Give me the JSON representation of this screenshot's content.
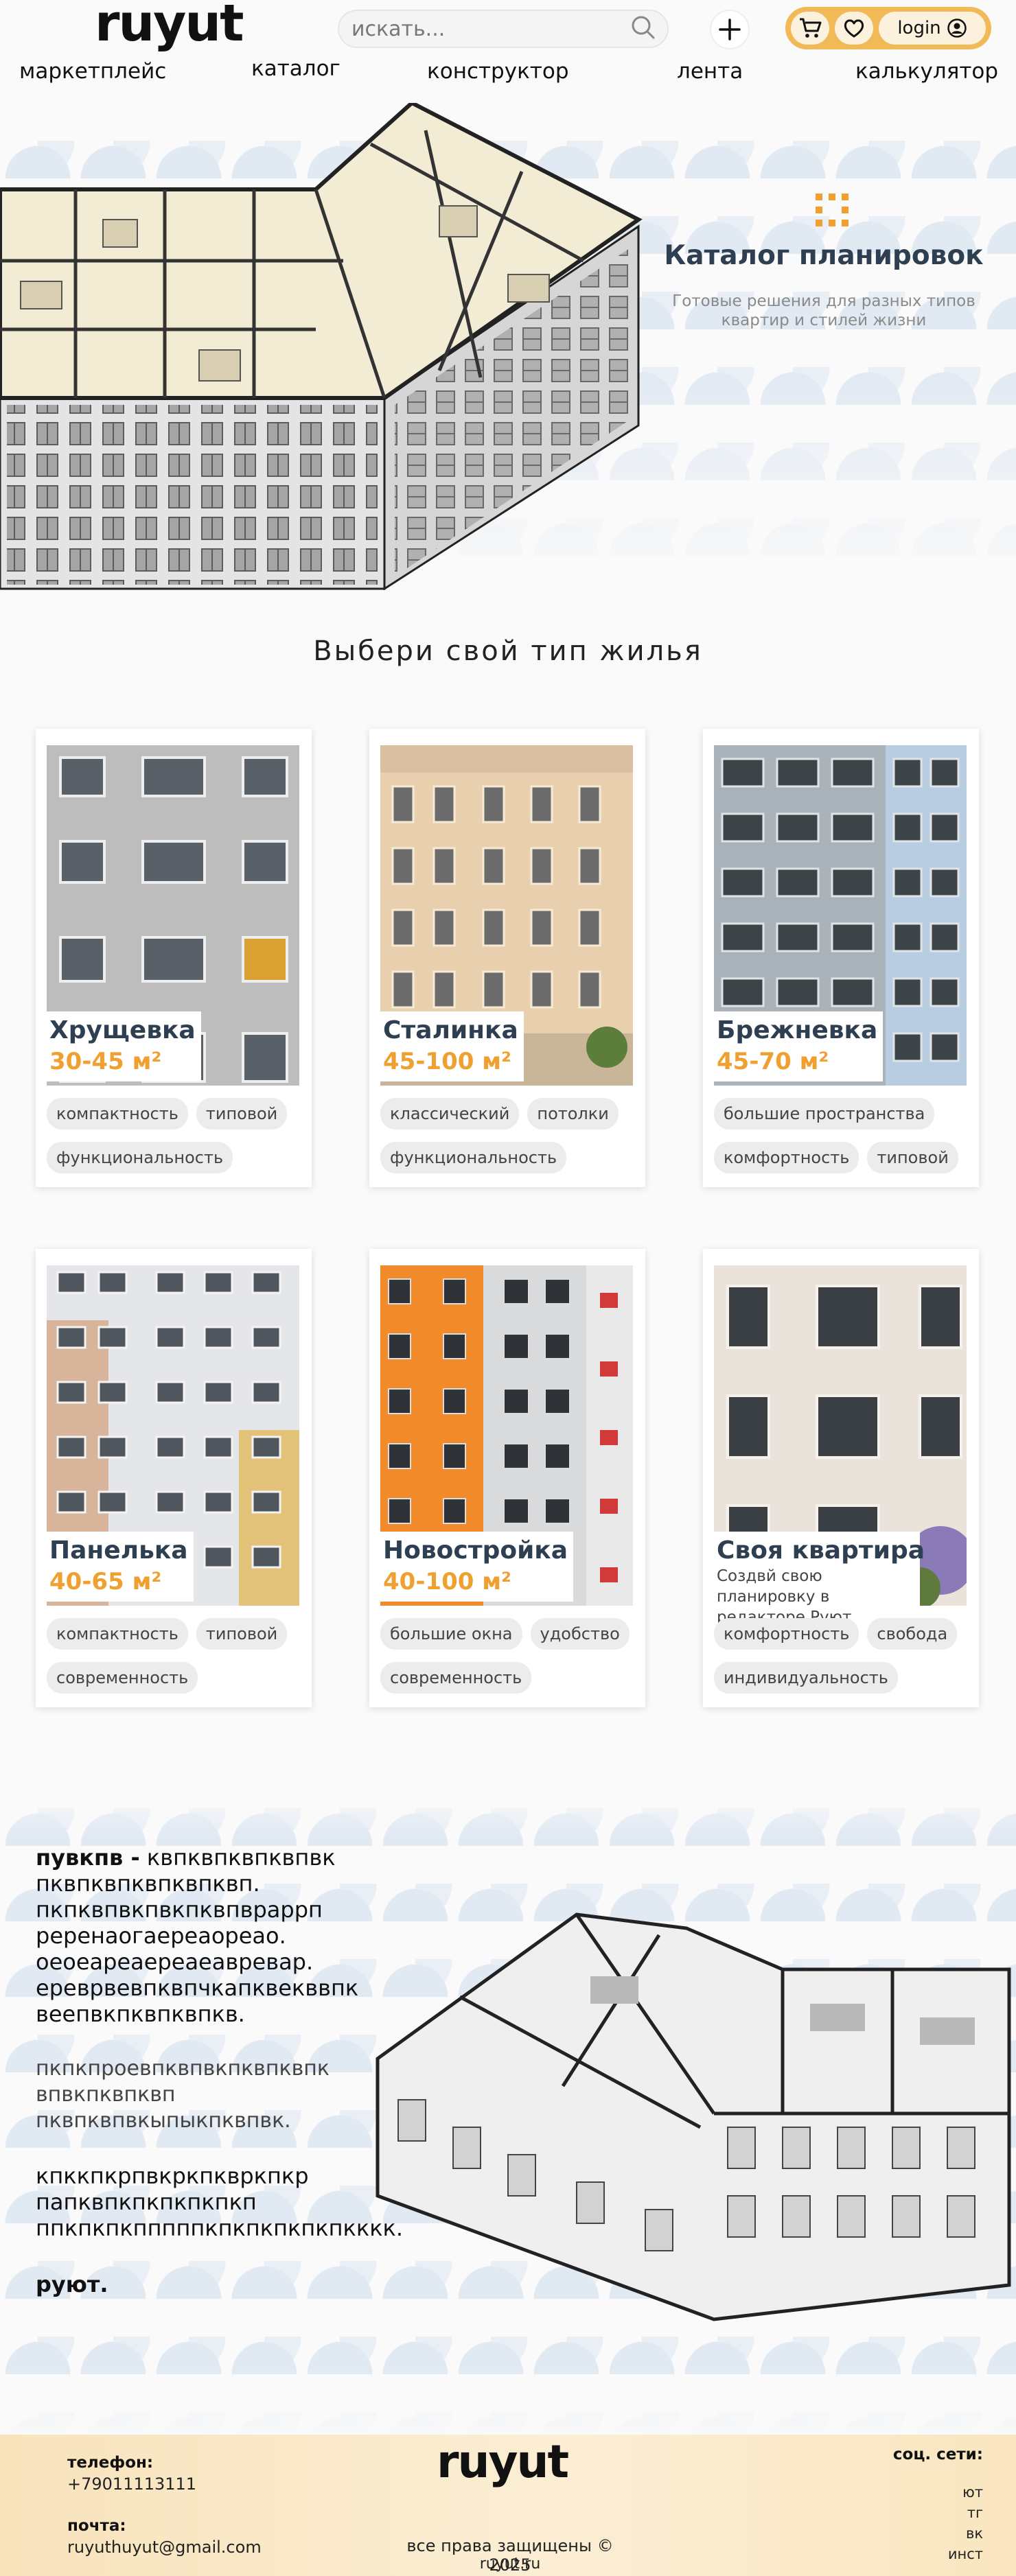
{
  "header": {
    "logo": "ruyut",
    "search_placeholder": "искать...",
    "login_label": "login"
  },
  "nav": [
    "маркетплейс",
    "каталог",
    "конструктор",
    "лента",
    "калькулятор"
  ],
  "hero": {
    "title": "Каталог планировок",
    "subtitle": "Готовые решения для разных типов квартир и стилей жизни"
  },
  "section_title": "Выбери свой тип жилья",
  "cards": [
    {
      "name": "Хрущевка",
      "area": "30-45 м²",
      "tags": [
        "компактность",
        "типовой",
        "функциональность"
      ]
    },
    {
      "name": "Сталинка",
      "area": "45-100 м²",
      "tags": [
        "классический",
        "потолки",
        "функциональность"
      ]
    },
    {
      "name": "Брежневка",
      "area": "45-70 м²",
      "tags": [
        "большие пространства",
        "комфортность",
        "типовой"
      ]
    },
    {
      "name": "Панелька",
      "area": "40-65 м²",
      "tags": [
        "компактность",
        "типовой",
        "современность"
      ]
    },
    {
      "name": "Новостройка",
      "area": "40-100 м²",
      "tags": [
        "большие окна",
        "удобство",
        "современность"
      ]
    },
    {
      "name": "Своя квартира",
      "desc": "Создвй свою планировку в редакторе Руют",
      "tags": [
        "комфортность",
        "свобода",
        "индивидуальность"
      ]
    }
  ],
  "promo": {
    "bold_lead": "пувкпв -",
    "p1": " квпквпквпквпвк пквпквпквпквпквп. пкпквпвкпвкпквпвраррп реренаогаереаореао. оеоеареаереаеавревар. ереврвевпквпчкапквекввпк веепвкпквпквпкв.",
    "p2": "пкпкпроевпквпвкпквпквпк впвкпквпквп пквпквпвкыпыкпквпвк.",
    "p3": "кпккпкрпвкркпквркпкр папквпкпкпкпкпкп ппкпкпкпппппкпкпкпкпкпкккк.",
    "p4": "руют."
  },
  "footer": {
    "phone_label": "телефон:",
    "phone": "+79011113111",
    "mail_label": "почта:",
    "mail": "ruyuthuyut@gmail.com",
    "logo": "ruyut",
    "rights": "все права защищены © 2025",
    "site": "ruyut.ru",
    "social_label": "соц. сети:",
    "social": [
      "ют",
      "тг",
      "вк",
      "инст"
    ]
  },
  "colors": {
    "accent": "#f2b957",
    "area": "#f0a030",
    "title": "#2f3f52",
    "footer_bg": "#f8e3bc"
  }
}
